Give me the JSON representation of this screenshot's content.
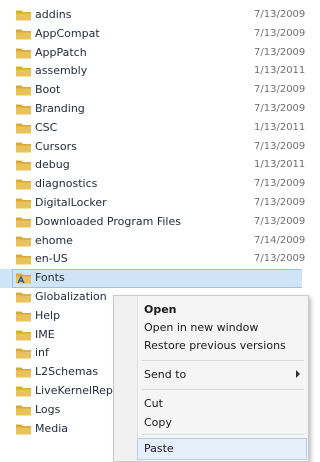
{
  "folders": [
    {
      "name": "addins",
      "date": "7/13/2009"
    },
    {
      "name": "AppCompat",
      "date": "7/13/2009"
    },
    {
      "name": "AppPatch",
      "date": "7/13/2009"
    },
    {
      "name": "assembly",
      "date": "1/13/2011"
    },
    {
      "name": "Boot",
      "date": "7/13/2009"
    },
    {
      "name": "Branding",
      "date": "7/13/2009"
    },
    {
      "name": "CSC",
      "date": "1/13/2011"
    },
    {
      "name": "Cursors",
      "date": "7/13/2009"
    },
    {
      "name": "debug",
      "date": "1/13/2011"
    },
    {
      "name": "diagnostics",
      "date": "7/13/2009"
    },
    {
      "name": "DigitalLocker",
      "date": "7/13/2009"
    },
    {
      "name": "Downloaded Program Files",
      "date": "7/13/2009"
    },
    {
      "name": "ehome",
      "date": "7/14/2009"
    },
    {
      "name": "en-US",
      "date": "7/13/2009"
    },
    {
      "name": "Fonts",
      "date": ""
    },
    {
      "name": "Globalization",
      "date": ""
    },
    {
      "name": "Help",
      "date": ""
    },
    {
      "name": "IME",
      "date": ""
    },
    {
      "name": "inf",
      "date": ""
    },
    {
      "name": "L2Schemas",
      "date": ""
    },
    {
      "name": "LiveKernelRep",
      "date": ""
    },
    {
      "name": "Logs",
      "date": ""
    },
    {
      "name": "Media",
      "date": ""
    }
  ],
  "selected_folder": "Fonts",
  "context_menu": {
    "open": "Open",
    "open_new_window": "Open in new window",
    "restore_previous": "Restore previous versions",
    "send_to": "Send to",
    "cut": "Cut",
    "copy": "Copy",
    "paste": "Paste"
  },
  "colors": {
    "folder": "#e8c25a",
    "selection": "#cfe4f7",
    "menu_background": "#f5f5f5"
  }
}
